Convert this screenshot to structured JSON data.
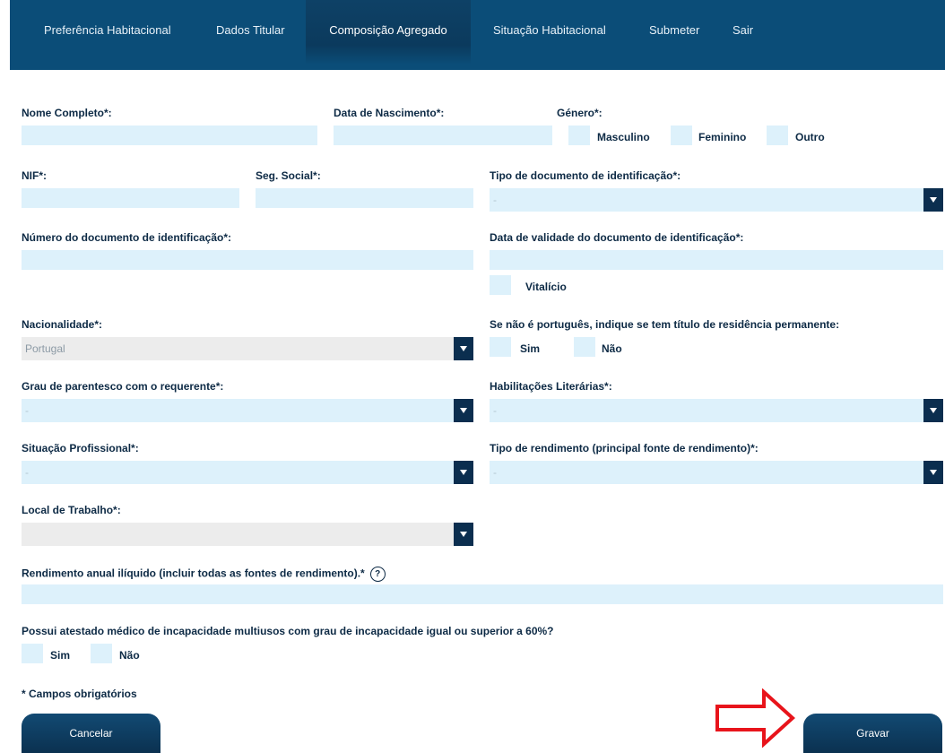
{
  "nav": {
    "tabs": [
      {
        "label": "Preferência Habitacional"
      },
      {
        "label": "Dados Titular"
      },
      {
        "label": "Composição Agregado"
      },
      {
        "label": "Situação Habitacional"
      },
      {
        "label": "Submeter"
      },
      {
        "label": "Sair"
      }
    ],
    "active": "Composição Agregado"
  },
  "form": {
    "nome_label": "Nome Completo*:",
    "nascimento_label": "Data de Nascimento*:",
    "genero_label": "Género*:",
    "genero_options": [
      "Masculino",
      "Feminino",
      "Outro"
    ],
    "nif_label": "NIF*:",
    "seg_social_label": "Seg. Social*:",
    "tipo_doc_label": "Tipo de documento de identificação*:",
    "tipo_doc_value": "-",
    "num_doc_label": "Número do documento de identificação*:",
    "validade_label": "Data de validade do documento de identificação*:",
    "vitalicio_label": "Vitalício",
    "nacionalidade_label": "Nacionalidade*:",
    "nacionalidade_value": "Portugal",
    "residencia_label": "Se não é português, indique se tem título de residência permanente:",
    "residencia_options": [
      "Sim",
      "Não"
    ],
    "parentesco_label": "Grau de parentesco com o requerente*:",
    "parentesco_value": "-",
    "habilitacoes_label": "Habilitações Literárias*:",
    "habilitacoes_value": "-",
    "situacao_label": "Situação Profissional*:",
    "situacao_value": "-",
    "rendimento_tipo_label": "Tipo de rendimento (principal fonte de rendimento)*:",
    "rendimento_tipo_value": "-",
    "local_label": "Local de Trabalho*:",
    "local_value": "",
    "rendimento_anual_label": "Rendimento anual ilíquido (incluir todas as fontes de rendimento).*",
    "help_glyph": "?",
    "atestado_label": "Possui atestado médico de incapacidade multiusos com grau de incapacidade igual ou superior a 60%?",
    "atestado_options": [
      "Sim",
      "Não"
    ],
    "obrigatorios_note": "* Campos obrigatórios"
  },
  "buttons": {
    "cancel_label": "Cancelar",
    "save_label": "Gravar"
  },
  "colors": {
    "nav_bg": "#0b4d78",
    "field_bg": "#ddf1fb",
    "annotation_arrow": "#e8141b"
  }
}
